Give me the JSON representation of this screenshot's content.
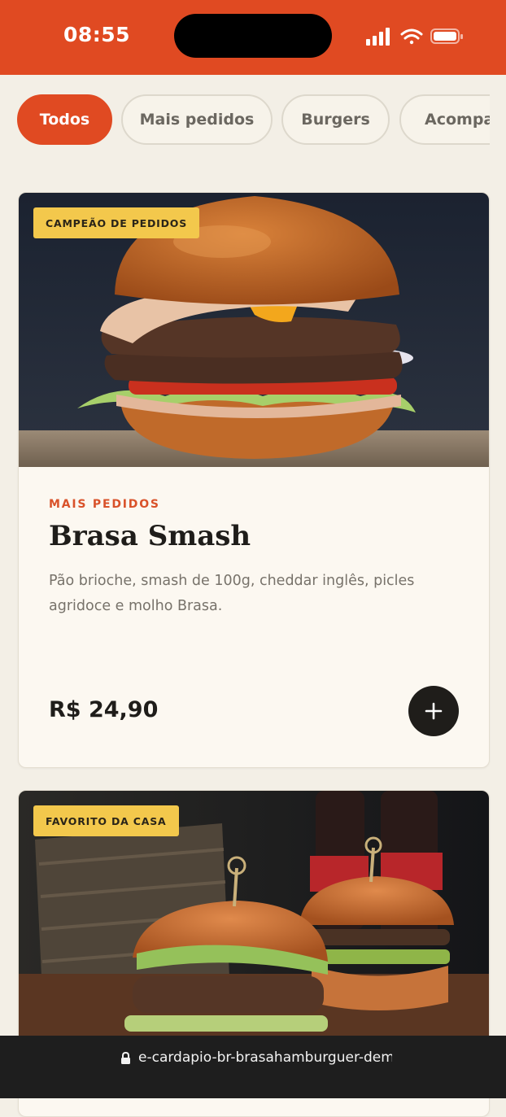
{
  "status": {
    "time": "08:55",
    "icons": [
      "signal-icon",
      "wifi-icon",
      "battery-icon"
    ]
  },
  "filters": [
    {
      "label": "Todos",
      "active": true
    },
    {
      "label": "Mais pedidos",
      "active": false
    },
    {
      "label": "Burgers",
      "active": false
    },
    {
      "label": "Acompanhamentos",
      "active": false
    }
  ],
  "products": [
    {
      "badge": "CAMPEÃO DE PEDIDOS",
      "category": "MAIS PEDIDOS",
      "name": "Brasa Smash",
      "description": "Pão brioche, smash de 100g, cheddar inglês, picles agridoce e molho Brasa.",
      "price": "R$ 24,90",
      "add_icon": "plus-icon"
    },
    {
      "badge": "FAVORITO DA CASA"
    }
  ],
  "browser": {
    "url": "e-cardapio-br-brasahamburguer-demo",
    "lock_icon": "lock-icon"
  },
  "colors": {
    "accent": "#e04a22",
    "badge": "#f3c84c",
    "background": "#f3efe6",
    "dark": "#1f1d1a"
  }
}
